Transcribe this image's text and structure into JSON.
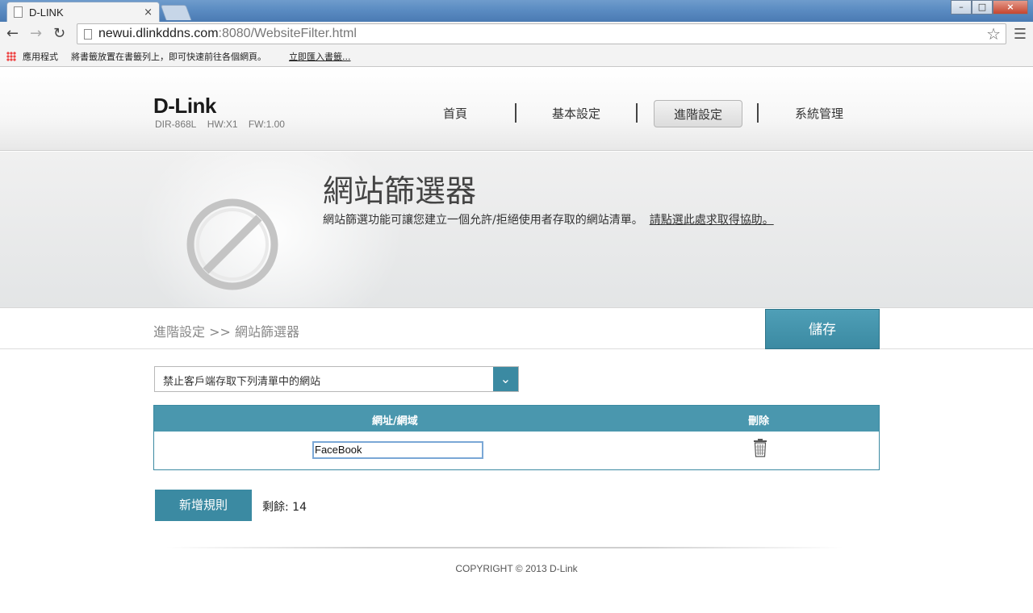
{
  "browser": {
    "tab_title": "D-LINK",
    "tab_close": "×",
    "url_host": "newui.dlinkddns.com",
    "url_rest": ":8080/WebsiteFilter.html",
    "window_buttons": {
      "minimize": "–",
      "maximize": "□",
      "close": "×"
    },
    "bookmarks": {
      "apps": "應用程式",
      "hint": "將書籤放置在書籤列上，即可快速前往各個網頁。",
      "import": "立即匯入書籤..."
    }
  },
  "router": {
    "logo": "D-Link",
    "model": "DIR-868L",
    "hw": "HW:X1",
    "fw": "FW:1.00",
    "menu": [
      {
        "label": "首頁"
      },
      {
        "label": "基本設定"
      },
      {
        "label": "進階設定",
        "active": true
      },
      {
        "label": "系統管理"
      }
    ]
  },
  "banner": {
    "title": "網站篩選器",
    "description": "網站篩選功能可讓您建立一個允許/拒絕使用者存取的網站清單。",
    "help_link": "請點選此處求取得協助。"
  },
  "breadcrumb": "進階設定 >> 網站篩選器",
  "save_label": "儲存",
  "filter_mode": {
    "selected": "禁止客戶端存取下列清單中的網站"
  },
  "rules_table": {
    "col_url": "網址/網域",
    "col_delete": "刪除",
    "rows": [
      {
        "url": "FaceBook"
      }
    ]
  },
  "add_rule_label": "新增規則",
  "remaining": "剩餘: 14",
  "copyright": "COPYRIGHT © 2013 D-Link",
  "colors": {
    "accent": "#3b8aa2",
    "header_bg": "#f7f7f7"
  }
}
